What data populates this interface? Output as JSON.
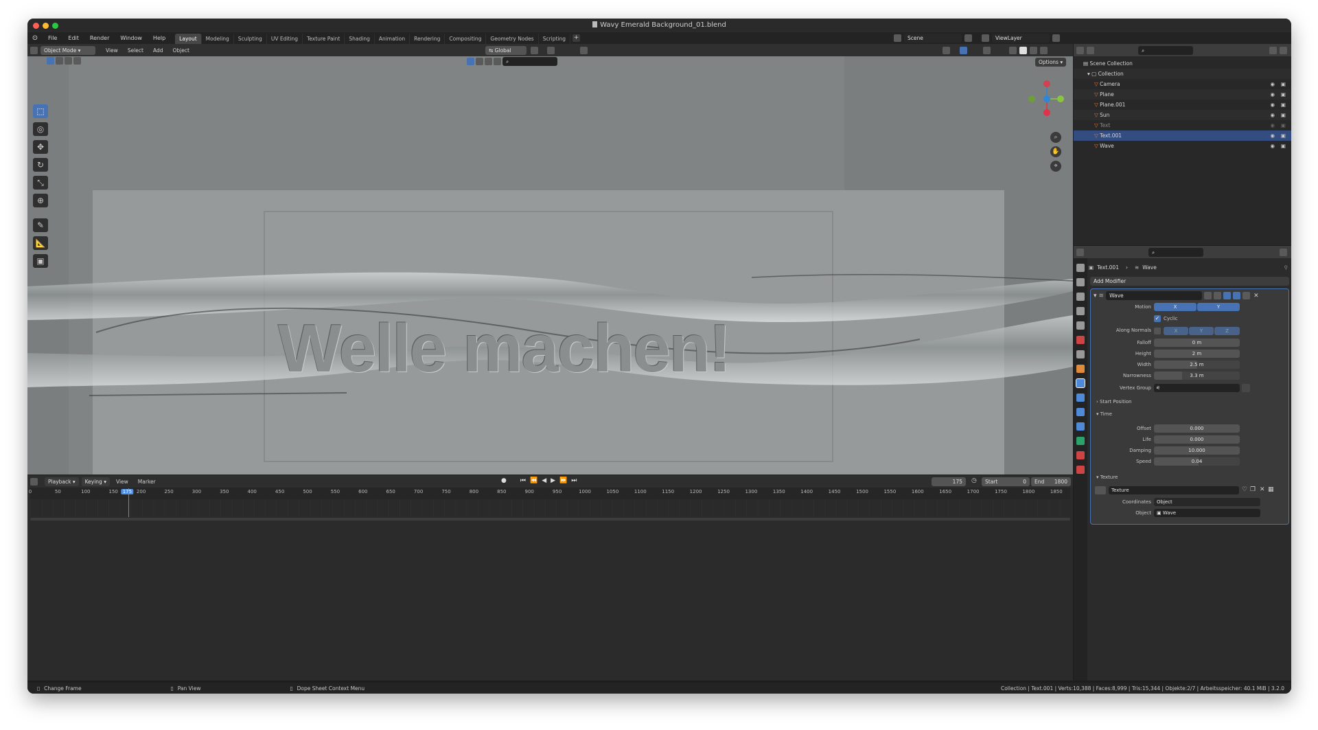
{
  "window": {
    "title": "Wavy Emerald Background_01.blend"
  },
  "menu": [
    "File",
    "Edit",
    "Render",
    "Window",
    "Help"
  ],
  "workspaces": [
    {
      "label": "Layout",
      "active": true
    },
    {
      "label": "Modeling"
    },
    {
      "label": "Sculpting"
    },
    {
      "label": "UV Editing"
    },
    {
      "label": "Texture Paint"
    },
    {
      "label": "Shading"
    },
    {
      "label": "Animation"
    },
    {
      "label": "Rendering"
    },
    {
      "label": "Compositing"
    },
    {
      "label": "Geometry Nodes"
    },
    {
      "label": "Scripting"
    }
  ],
  "scene": {
    "name": "Scene",
    "view_layer": "ViewLayer"
  },
  "viewport": {
    "mode": "Object Mode",
    "menus": [
      "View",
      "Select",
      "Add",
      "Object"
    ],
    "orientation": "Global",
    "options_label": "Options",
    "text_3d": "Welle machen!",
    "tools": [
      {
        "icon": "select-box-icon",
        "glyph": "⬚",
        "active": true
      },
      {
        "icon": "cursor-icon",
        "glyph": "◎"
      },
      {
        "icon": "move-icon",
        "glyph": "✥"
      },
      {
        "icon": "rotate-icon",
        "glyph": "↻"
      },
      {
        "icon": "scale-icon",
        "glyph": "⤡"
      },
      {
        "icon": "transform-icon",
        "glyph": "⊕"
      },
      {
        "icon": "annotate-icon",
        "glyph": "✎"
      },
      {
        "icon": "measure-icon",
        "glyph": "📐"
      },
      {
        "icon": "add-cube-icon",
        "glyph": "▣"
      }
    ]
  },
  "outliner": {
    "root": "Scene Collection",
    "collection": "Collection",
    "items": [
      {
        "name": "Camera",
        "icon": "camera-icon",
        "color": "#e07a3e"
      },
      {
        "name": "Plane",
        "icon": "mesh-icon",
        "color": "#e07a3e"
      },
      {
        "name": "Plane.001",
        "icon": "mesh-icon",
        "color": "#e07a3e"
      },
      {
        "name": "Sun",
        "icon": "light-icon",
        "color": "#e07a3e"
      },
      {
        "name": "Text",
        "icon": "text-icon",
        "color": "#e07a3e",
        "dim": true
      },
      {
        "name": "Text.001",
        "icon": "text-icon",
        "color": "#e07a3e",
        "selected": true
      },
      {
        "name": "Wave",
        "icon": "mesh-icon",
        "color": "#e07a3e"
      }
    ]
  },
  "properties": {
    "breadcrumb_object": "Text.001",
    "breadcrumb_modifier": "Wave",
    "add_modifier": "Add Modifier",
    "modifier_name": "Wave",
    "motion_label": "Motion",
    "motion_x": "X",
    "motion_y": "Y",
    "cyclic_label": "Cyclic",
    "along_normals_label": "Along Normals",
    "along_x": "X",
    "along_y": "Y",
    "along_z": "Z",
    "falloff_label": "Falloff",
    "falloff": "0 m",
    "height_label": "Height",
    "height": "2 m",
    "width_label": "Width",
    "width": "2.5 m",
    "narrowness_label": "Narrowness",
    "narrowness": "3.3 m",
    "vertex_group_label": "Vertex Group",
    "start_position": "Start Position",
    "time_section": "Time",
    "offset_label": "Offset",
    "offset": "0.000",
    "life_label": "Life",
    "life": "0.000",
    "damping_label": "Damping",
    "damping": "10.000",
    "speed_label": "Speed",
    "speed": "0.04",
    "texture_section": "Texture",
    "texture_name": "Texture",
    "coordinates_label": "Coordinates",
    "coordinates": "Object",
    "object_label": "Object",
    "object": "Wave"
  },
  "timeline": {
    "menus": [
      "Playback",
      "Keying",
      "View",
      "Marker"
    ],
    "current_frame": "175",
    "start_label": "Start",
    "start": "0",
    "end_label": "End",
    "end": "1800",
    "ticks": [
      "0",
      "50",
      "100",
      "150",
      "175",
      "200",
      "250",
      "300",
      "350",
      "400",
      "450",
      "500",
      "550",
      "600",
      "650",
      "700",
      "750",
      "800",
      "850",
      "900",
      "950",
      "1000",
      "1050",
      "1100",
      "1150",
      "1200",
      "1250",
      "1300",
      "1350",
      "1400",
      "1450",
      "1500",
      "1550",
      "1600",
      "1650",
      "1700",
      "1750",
      "1800",
      "1850"
    ],
    "playhead_fraction": 0.0946
  },
  "statusbar": {
    "hint1": "Change Frame",
    "hint2": "Pan View",
    "hint3": "Dope Sheet Context Menu",
    "info": "Collection | Text.001 | Verts:10,388 | Faces:8,999 | Tris:15,344 | Objekte:2/7 | Arbeitsspeicher: 40.1 MiB | 3.2.0"
  }
}
